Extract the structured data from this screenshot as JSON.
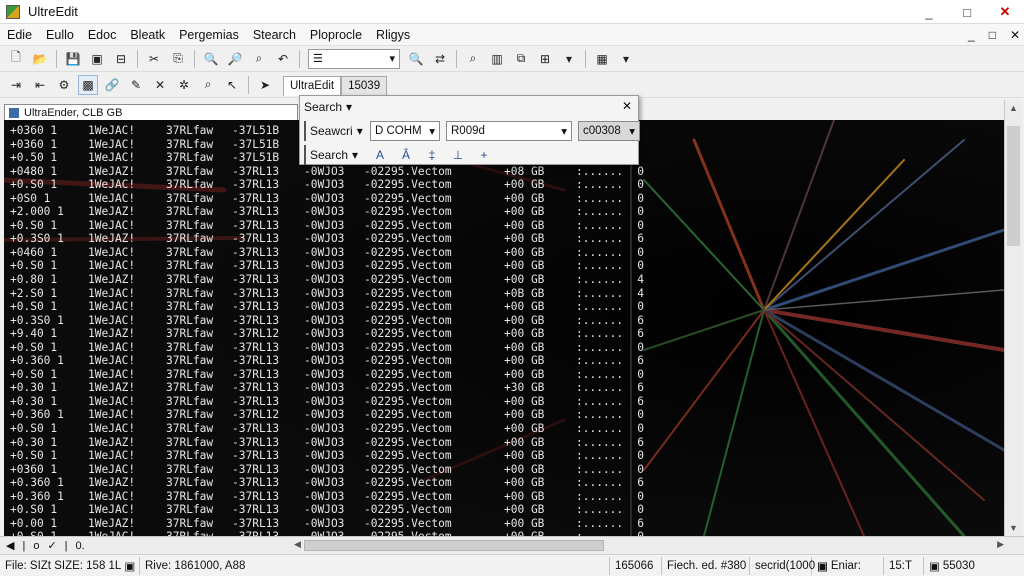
{
  "window": {
    "title": "UltreEdit",
    "controls": [
      "_",
      "□",
      "✕"
    ]
  },
  "menu": {
    "items": [
      "Edie",
      "Eullo",
      "Edoc",
      "Bleatk",
      "Pergemias",
      "Stearch",
      "Ploprocle",
      "Rligys"
    ],
    "mdi_controls": [
      "_",
      "□",
      "✕"
    ]
  },
  "tabs": {
    "doc_tab_1": "UltraEdit",
    "doc_tab_2": "15039"
  },
  "file_tab": {
    "label": "UltraEnder, CLB GB"
  },
  "find_popup": {
    "title": "Search",
    "row1_label": "Seawcri",
    "combo_1": "D COHM",
    "combo_2": "R009d",
    "combo_3": "c00308",
    "row2_label": "Search",
    "close": "✕"
  },
  "code": {
    "rows": [
      [
        "+0360 1",
        "1WeJAC!",
        "37RLfaw",
        "-37L51B",
        "",
        "",
        "",
        "",
        ""
      ],
      [
        "+0360 1",
        "1WeJAC!",
        "37RLfaw",
        "-37L51B",
        "",
        "",
        "",
        "",
        ""
      ],
      [
        "+0.50 1",
        "1WeJAC!",
        "37RLfaw",
        "-37L51B",
        "",
        "",
        "",
        "",
        ""
      ],
      [
        "+0480 1",
        "1WeJAZ!",
        "37RLfaw",
        "-37RL13",
        "-0WJO3",
        "-02295.Vectom",
        "+08 GB",
        ":......",
        "0"
      ],
      [
        "+0.S0 1",
        "1WeJAC!",
        "37RLfaw",
        "-37RL13",
        "-0WJO3",
        "-02295.Vectom",
        "+00 GB",
        ":......",
        "0"
      ],
      [
        "+0S0 1",
        "1WeJAC!",
        "37RLfaw",
        "-37RL13",
        "-0WJO3",
        "-02295.Vectom",
        "+00 GB",
        ":......",
        "0"
      ],
      [
        "+2.000 1",
        "1WeJAZ!",
        "37RLfaw",
        "-37RL13",
        "-0WJO3",
        "-02295.Vectom",
        "+00 GB",
        ":......",
        "0"
      ],
      [
        "+0.S0 1",
        "1WeJAC!",
        "37RLfaw",
        "-37RL13",
        "-0WJO3",
        "-02295.Vectom",
        "+00 GB",
        ":......",
        "0"
      ],
      [
        "+0.3S0 1",
        "1WeJAZ!",
        "37RLfaw",
        "-37RL13",
        "-0WJO3",
        "-02295.Vectom",
        "+00 GB",
        ":......",
        "6"
      ],
      [
        "+0460 1",
        "1WeJAC!",
        "37RLfaw",
        "-37RL13",
        "-0WJO3",
        "-02295.Vectom",
        "+00 GB",
        ":......",
        "0"
      ],
      [
        "+0.S0 1",
        "1WeJAC!",
        "37RLfaw",
        "-37RL13",
        "-0WJO3",
        "-02295.Vectom",
        "+00 GB",
        ":......",
        "0"
      ],
      [
        "+0.80 1",
        "1WeJAZ!",
        "37RLfaw",
        "-37RL13",
        "-0WJO3",
        "-02295.Vectom",
        "+00 GB",
        ":......",
        "4"
      ],
      [
        "+2.S0 1",
        "1WeJAC!",
        "37RLfaw",
        "-37RL13",
        "-0WJO3",
        "-02295.Vectom",
        "+0B GB",
        ":......",
        "4"
      ],
      [
        "+0.S0 1",
        "1WeJAC!",
        "37RLfaw",
        "-37RL13",
        "-0WJO3",
        "-02295.Vectom",
        "+00 GB",
        ":......",
        "0"
      ],
      [
        "+0.3S0 1",
        "1WeJAC!",
        "37RLfaw",
        "-37RL13",
        "-0WJO3",
        "-02295.Vectom",
        "+00 GB",
        ":......",
        "6"
      ],
      [
        "+9.40 1",
        "1WeJAZ!",
        "37RLfaw",
        "-37RL12",
        "-0WJO3",
        "-02295.Vectom",
        "+00 GB",
        ":......",
        "6"
      ],
      [
        "+0.S0 1",
        "1WeJAC!",
        "37RLfaw",
        "-37RL13",
        "-0WJO3",
        "-02295.Vectom",
        "+00 GB",
        ":......",
        "0"
      ],
      [
        "+0.360 1",
        "1WeJAC!",
        "37RLfaw",
        "-37RL13",
        "-0WJO3",
        "-02295.Vectom",
        "+00 GB",
        ":......",
        "6"
      ],
      [
        "+0.S0 1",
        "1WeJAC!",
        "37RLfaw",
        "-37RL13",
        "-0WJO3",
        "-02295.Vectom",
        "+00 GB",
        ":......",
        "0"
      ],
      [
        "+0.30 1",
        "1WeJAZ!",
        "37RLfaw",
        "-37RL13",
        "-0WJO3",
        "-02295.Vectom",
        "+30 GB",
        ":......",
        "6"
      ],
      [
        "+0.30 1",
        "1WeJAC!",
        "37RLfaw",
        "-37RL13",
        "-0WJO3",
        "-02295.Vectom",
        "+00 GB",
        ":......",
        "6"
      ],
      [
        "+0.360 1",
        "1WeJAC!",
        "37RLfaw",
        "-37RL12",
        "-0WJO3",
        "-02295.Vectom",
        "+00 GB",
        ":......",
        "0"
      ],
      [
        "+0.S0 1",
        "1WeJAC!",
        "37RLfaw",
        "-37RL13",
        "-0WJO3",
        "-02295.Vectom",
        "+00 GB",
        ":......",
        "0"
      ],
      [
        "+0.30 1",
        "1WeJAZ!",
        "37RLfaw",
        "-37RL13",
        "-0WJO3",
        "-02295.Vectom",
        "+00 GB",
        ":......",
        "6"
      ],
      [
        "+0.S0 1",
        "1WeJAC!",
        "37RLfaw",
        "-37RL13",
        "-0WJO3",
        "-02295.Vectom",
        "+00 GB",
        ":......",
        "0"
      ],
      [
        "+0360 1",
        "1WeJAC!",
        "37RLfaw",
        "-37RL13",
        "-0WJO3",
        "-02295.Vectom",
        "+00 GB",
        ":......",
        "0"
      ],
      [
        "+0.360 1",
        "1WeJAZ!",
        "37RLfaw",
        "-37RL13",
        "-0WJO3",
        "-02295.Vectom",
        "+00 GB",
        ":......",
        "6"
      ],
      [
        "+0.360 1",
        "1WeJAC!",
        "37RLfaw",
        "-37RL13",
        "-0WJO3",
        "-02295.Vectom",
        "+00 GB",
        ":......",
        "0"
      ],
      [
        "+0.S0 1",
        "1WeJAC!",
        "37RLfaw",
        "-37RL13",
        "-0WJO3",
        "-02295.Vectom",
        "+00 GB",
        ":......",
        "0"
      ],
      [
        "+0.00 1",
        "1WeJAZ!",
        "37RLfaw",
        "-37RL13",
        "-0WJO3",
        "-02295.Vectom",
        "+00 GB",
        ":......",
        "6"
      ],
      [
        "+0.S0 1",
        "1WeJAC!",
        "37RLfaw",
        "-37RL13",
        "-0WJO3",
        "-02295.Vectom",
        "+00 GB",
        ":......",
        "0"
      ]
    ]
  },
  "hscroll": {
    "left_items": [
      "◀",
      "|",
      "o",
      "✓",
      "|",
      "0."
    ]
  },
  "status": {
    "cells": [
      "File: SIZt SIZE: 158 1L",
      "Rive: 1861000, A88",
      "165066",
      "Fiech. ed. #380",
      "secrid(1000",
      "Eniar:",
      "15:T",
      "55030"
    ]
  },
  "colors": {
    "editor_bg": "#050505",
    "text": "#e6e6e6",
    "accent": "#3c6ca8"
  }
}
